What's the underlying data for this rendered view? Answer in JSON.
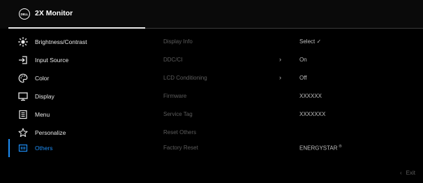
{
  "header": {
    "logo_text": "DELL",
    "title": "2X Monitor"
  },
  "menu": [
    {
      "label": "Brightness/Contrast",
      "icon": "brightness-icon"
    },
    {
      "label": "Input Source",
      "icon": "input-source-icon"
    },
    {
      "label": "Color",
      "icon": "color-palette-icon"
    },
    {
      "label": "Display",
      "icon": "display-icon"
    },
    {
      "label": "Menu",
      "icon": "menu-icon"
    },
    {
      "label": "Personalize",
      "icon": "star-icon"
    },
    {
      "label": "Others",
      "icon": "others-icon",
      "active": true
    }
  ],
  "settings": [
    {
      "key": "Display Info",
      "value": "Select ✓",
      "arrow": ""
    },
    {
      "key": "DDC/CI",
      "value": "On",
      "arrow": "›"
    },
    {
      "key": "LCD Conditioning",
      "value": "Off",
      "arrow": "›"
    },
    {
      "key": "Firmware",
      "value": "XXXXXX",
      "arrow": ""
    },
    {
      "key": "Service Tag",
      "value": "XXXXXXX",
      "arrow": ""
    },
    {
      "key": "Reset Others",
      "value": "",
      "arrow": ""
    },
    {
      "key": "Factory Reset",
      "value": "ENERGYSTAR",
      "value_sup": "®",
      "arrow": ""
    }
  ],
  "footer": {
    "exit_label": "Exit",
    "exit_chevron": "‹"
  },
  "colors": {
    "accent": "#1d8df5",
    "background": "#000000",
    "muted_text": "#5d5d5d"
  }
}
